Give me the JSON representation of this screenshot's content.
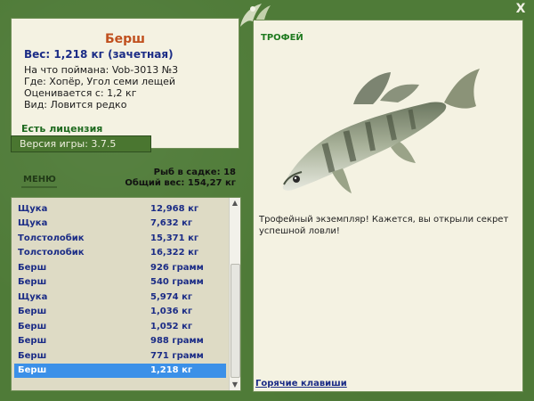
{
  "window": {
    "close_label": "X"
  },
  "fish": {
    "name": "Берш",
    "weight_line": "Вес: 1,218 кг (зачетная)",
    "details": [
      "На что поймана: Vob-3013 №3",
      "Где: Хопёр, Угол семи лещей",
      "Оценивается с: 1,2 кг",
      "Вид: Ловится редко"
    ]
  },
  "license_text": "Есть лицензия",
  "version_text": "Версия игры: 3.7.5",
  "menu_label": "МЕНЮ",
  "totals": {
    "count_line": "Рыб в садке: 18",
    "weight_line": "Общий вес: 154,27 кг"
  },
  "catch_list": [
    {
      "name": "Щука",
      "weight": "12,968 кг"
    },
    {
      "name": "Щука",
      "weight": "7,632 кг"
    },
    {
      "name": "Толстолобик",
      "weight": "15,371 кг"
    },
    {
      "name": "Толстолобик",
      "weight": "16,322 кг"
    },
    {
      "name": "Берш",
      "weight": "926 грамм"
    },
    {
      "name": "Берш",
      "weight": "540 грамм"
    },
    {
      "name": "Щука",
      "weight": "5,974 кг"
    },
    {
      "name": "Берш",
      "weight": "1,036 кг"
    },
    {
      "name": "Берш",
      "weight": "1,052 кг"
    },
    {
      "name": "Берш",
      "weight": "988 грамм"
    },
    {
      "name": "Берш",
      "weight": "771 грамм"
    },
    {
      "name": "Берш",
      "weight": "1,218 кг",
      "selected": true
    }
  ],
  "trophy": {
    "title": "ТРОФЕЙ",
    "text": "Трофейный экземпляр! Кажется, вы открыли секрет успешной ловли!"
  },
  "hotkeys_label": "Горячие клавиши",
  "colors": {
    "frame": "#4f7b38",
    "panel": "#f4f2e2",
    "fish_name": "#c0501e",
    "list_text": "#1b2c86",
    "selection": "#3b90e8"
  }
}
